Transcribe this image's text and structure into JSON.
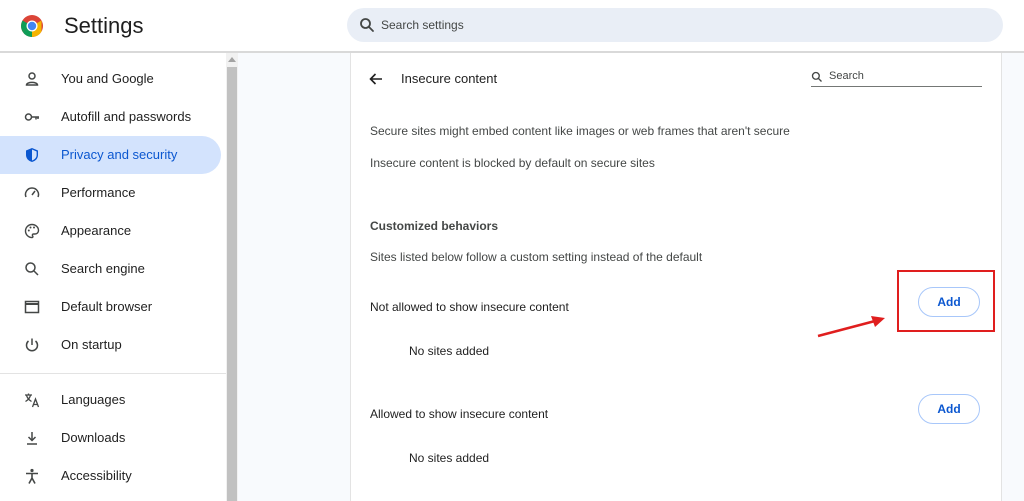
{
  "header": {
    "app_title": "Settings",
    "search_placeholder": "Search settings"
  },
  "sidebar": {
    "items": [
      {
        "label": "You and Google",
        "icon": "person-icon"
      },
      {
        "label": "Autofill and passwords",
        "icon": "key-icon"
      },
      {
        "label": "Privacy and security",
        "icon": "shield-icon",
        "active": true
      },
      {
        "label": "Performance",
        "icon": "speedometer-icon"
      },
      {
        "label": "Appearance",
        "icon": "palette-icon"
      },
      {
        "label": "Search engine",
        "icon": "search-icon"
      },
      {
        "label": "Default browser",
        "icon": "browser-window-icon"
      },
      {
        "label": "On startup",
        "icon": "power-icon"
      },
      {
        "label": "Languages",
        "icon": "translate-icon"
      },
      {
        "label": "Downloads",
        "icon": "download-icon"
      },
      {
        "label": "Accessibility",
        "icon": "accessibility-icon"
      }
    ]
  },
  "page": {
    "title": "Insecure content",
    "search_placeholder": "Search",
    "description_1": "Secure sites might embed content like images or web frames that aren't secure",
    "description_2": "Insecure content is blocked by default on secure sites",
    "custom_title": "Customized behaviors",
    "custom_subtitle": "Sites listed below follow a custom setting instead of the default",
    "not_allowed": {
      "label": "Not allowed to show insecure content",
      "button": "Add",
      "empty": "No sites added"
    },
    "allowed": {
      "label": "Allowed to show insecure content",
      "button": "Add",
      "empty": "No sites added"
    }
  },
  "colors": {
    "accent": "#0b57d0",
    "active_nav_bg": "#d3e3fd",
    "annotation_red": "#e01e1e"
  }
}
